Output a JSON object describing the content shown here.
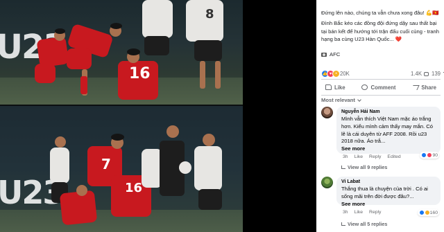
{
  "post": {
    "caption_line1": "Đứng lên nào, chúng ta vẫn chưa xong đâu! 💪🇻🇳",
    "caption_line2": "Đình Bắc kéo các đồng đội đứng dậy sau thất bại tại bán kết để hướng tới trận đấu cuối cùng - tranh hạng ba cùng U23 Hàn Quốc... ❤️",
    "source": "AFC",
    "reaction_count": "20K",
    "comments_count": "1.4K",
    "shares_count": "139"
  },
  "photo": {
    "banner_top": "U23",
    "banner_bottom": "U23",
    "jersey_number_top": "16",
    "jersey_number_bottom_left": "7",
    "jersey_number_bottom_right": "16",
    "jersey_number_white": "8"
  },
  "actions": {
    "like": "Like",
    "comment": "Comment",
    "share": "Share"
  },
  "filter": {
    "label": "Most relevant"
  },
  "comments": [
    {
      "name": "Nguyễn Hải Nam",
      "text": "Mình vẫn thích Việt Nam mặc áo trắng hơn. Kiểu mình cảm thấy may mắn. Có lẽ là cái duyên từ AFF 2008. Rồi u23 2018 nữa. Áo trắ...",
      "see_more": "See more",
      "time": "3h",
      "like": "Like",
      "reply": "Reply",
      "edited": "Edited",
      "reaction_count": "90",
      "view_replies": "View all 9 replies"
    },
    {
      "name": "Vi Labat",
      "text": "Thắng thua là chuyện của trời . Có ai sống mãi trên đời được đâu?...",
      "see_more": "See more",
      "time": "3h",
      "like": "Like",
      "reply": "Reply",
      "reaction_count": "160",
      "view_replies": "View all 5 replies"
    }
  ],
  "colors": {
    "jersey_red": "#c8191f",
    "facebook_blue": "#1877f2",
    "love_red": "#f33e58",
    "haha_yellow": "#f7b125"
  }
}
